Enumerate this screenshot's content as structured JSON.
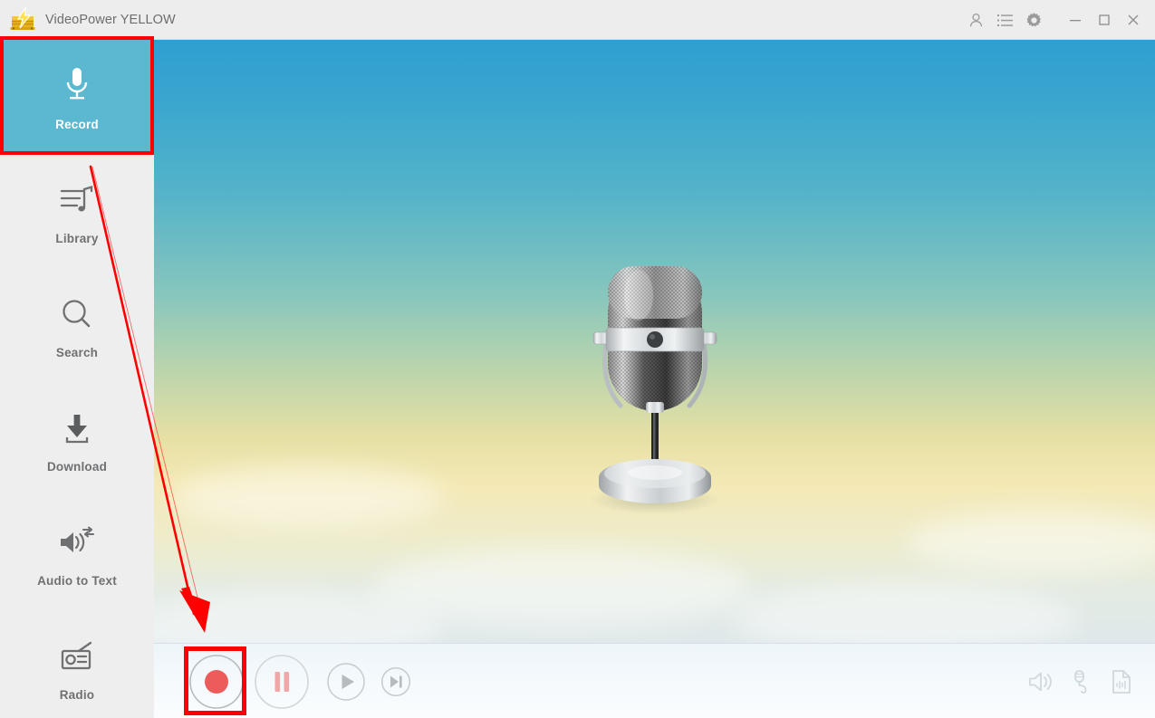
{
  "window": {
    "title": "VideoPower YELLOW",
    "logo_icon": "yellow-lightning-drawer-logo",
    "controls": [
      {
        "name": "account-icon",
        "label": "Account"
      },
      {
        "name": "list-icon",
        "label": "Task List"
      },
      {
        "name": "gear-icon",
        "label": "Settings"
      },
      {
        "name": "minimize-icon",
        "label": "Minimize"
      },
      {
        "name": "maximize-icon",
        "label": "Maximize"
      },
      {
        "name": "close-icon",
        "label": "Close"
      }
    ]
  },
  "sidebar": {
    "active_index": 0,
    "active_bg": "#5bb8d0",
    "items": [
      {
        "label": "Record",
        "icon": "microphone-icon"
      },
      {
        "label": "Library",
        "icon": "music-list-icon"
      },
      {
        "label": "Search",
        "icon": "search-icon"
      },
      {
        "label": "Download",
        "icon": "download-icon"
      },
      {
        "label": "Audio to Text",
        "icon": "speaker-convert-icon"
      },
      {
        "label": "Radio",
        "icon": "radio-icon"
      }
    ]
  },
  "stage": {
    "artwork": "retro-silver-microphone",
    "background": "sky-gradient-blue-to-cream"
  },
  "transport": {
    "buttons": [
      {
        "label": "Record",
        "icon": "record-dot-icon",
        "state": "enabled"
      },
      {
        "label": "Pause",
        "icon": "pause-bars-icon",
        "state": "disabled"
      },
      {
        "label": "Play",
        "icon": "play-triangle-icon",
        "state": "disabled"
      },
      {
        "label": "Next",
        "icon": "skip-next-icon",
        "state": "disabled"
      }
    ]
  },
  "bottom_right": {
    "buttons": [
      {
        "label": "Output Volume",
        "icon": "speaker-icon"
      },
      {
        "label": "Microphone Input",
        "icon": "microphone-plug-icon"
      },
      {
        "label": "Recorded File",
        "icon": "audio-file-icon"
      }
    ]
  },
  "annotations": {
    "highlight_color": "#fe0000",
    "record_menu_highlight": "Record",
    "record_button_highlight": "Record",
    "arrow": "red-arrow-from-sidebar-to-record-button"
  }
}
